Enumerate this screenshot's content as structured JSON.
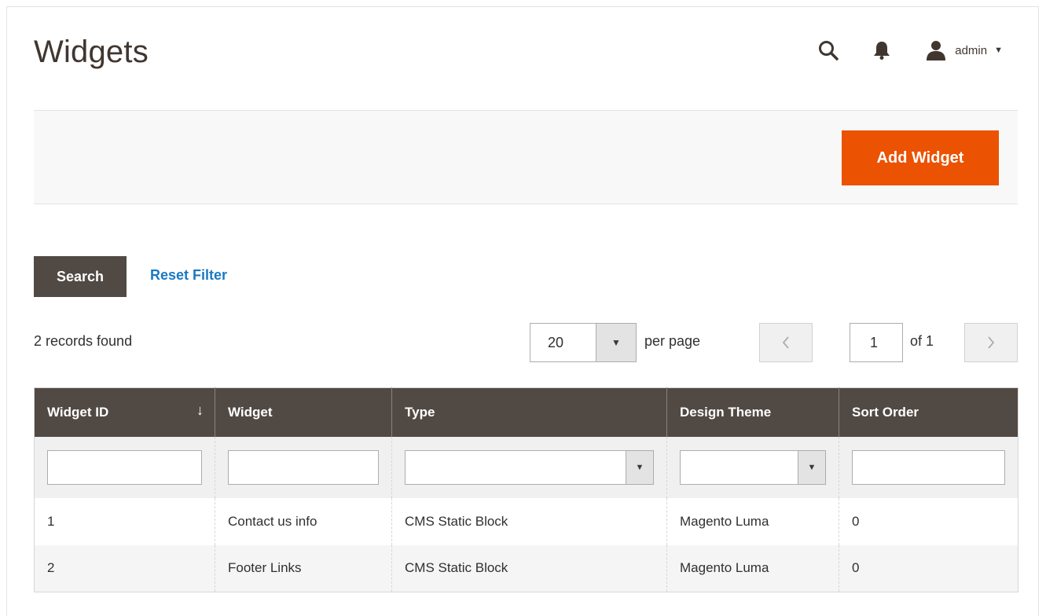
{
  "page": {
    "title": "Widgets"
  },
  "header": {
    "user_name": "admin"
  },
  "actions": {
    "add_label": "Add Widget"
  },
  "filters": {
    "search_label": "Search",
    "reset_label": "Reset Filter"
  },
  "records": {
    "found_text": "2 records found"
  },
  "pagination": {
    "per_page_value": "20",
    "per_page_label": "per page",
    "current_page": "1",
    "total_pages_text": "of 1"
  },
  "table": {
    "columns": [
      "Widget ID",
      "Widget",
      "Type",
      "Design Theme",
      "Sort Order"
    ],
    "sort_indicator": "↓",
    "rows": [
      [
        "1",
        "Contact us info",
        "CMS Static Block",
        "Magento Luma",
        "0"
      ],
      [
        "2",
        "Footer Links",
        "CMS Static Block",
        "Magento Luma",
        "0"
      ]
    ]
  },
  "colors": {
    "accent": "#eb5202",
    "dark_button": "#514943",
    "link": "#1979c3"
  },
  "icons": {
    "search": "search-icon",
    "notifications": "bell-icon",
    "user": "user-icon"
  }
}
